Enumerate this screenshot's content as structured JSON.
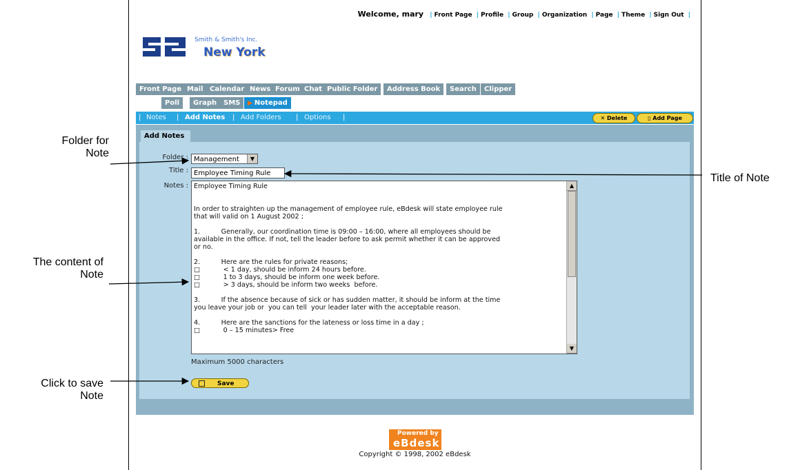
{
  "topnav": {
    "welcome": "Welcome, mary",
    "links": [
      "Front Page",
      "Profile",
      "Group",
      "Organization",
      "Page",
      "Theme",
      "Sign Out"
    ]
  },
  "brand": {
    "logo_text": "S2",
    "company": "Smith & Smith's Inc.",
    "city": "New York"
  },
  "tabs_row1": [
    "Front Page",
    "Mail",
    "Calendar",
    "News",
    "Forum",
    "Chat",
    "Public Folder",
    "Address Book",
    "Search",
    "Clipper"
  ],
  "tabs_row2": [
    "Poll",
    "Graph",
    "SMS",
    "Notepad"
  ],
  "active_tab": "Notepad",
  "subnav": {
    "items": [
      "Notes",
      "Add Notes",
      "Add Folders",
      "Options"
    ],
    "active": "Add Notes",
    "delete_label": "Delete",
    "add_page_label": "Add Page"
  },
  "form": {
    "section_title": "Add Notes",
    "folder_label": "Folder :",
    "folder_value": "Management",
    "title_label": "Title :",
    "title_value": "Employee Timing Rule",
    "notes_label": "Notes :",
    "notes_value": "Employee Timing Rule\n\n\nIn order to straighten up the management of employee rule, eBdesk will state employee rule\nthat will valid on 1 August 2002 ;\n\n1.          Generally, our coordination time is 09:00 – 16:00, where all employees should be\navailable in the office. If not, tell the leader before to ask permit whether it can be approved\nor no.\n\n2.          Here are the rules for private reasons;\n□           < 1 day, should be inform 24 hours before.\n□           1 to 3 days, should be inform one week before.\n□           > 3 days, should be inform two weeks  before.\n\n3.          If the absence because of sick or has sudden matter, it should be inform at the time\nyou leave your job or  you can tell  your leader later with the acceptable reason.\n\n4.          Here are the sanctions for the lateness or loss time in a day ;\n□           0 – 15 minutes> Free",
    "max_chars_text": "Maximum 5000 characters",
    "save_label": "Save"
  },
  "footer": {
    "powered_line1": "Powered by",
    "powered_line2": "eBdesk",
    "copyright": "Copyright © 1998, 2002 eBdesk"
  },
  "annotations": {
    "folder": [
      "Folder for",
      "Note"
    ],
    "title": "Title of Note",
    "content": [
      "The content of",
      "Note"
    ],
    "save": [
      "Click to save",
      "Note"
    ]
  },
  "colors": {
    "tab_gray": "#7d98a5",
    "tab_active": "#1c8fd0",
    "subbar": "#2ca8e0",
    "panel": "#8fb3c6",
    "panel_inner": "#b8d8ea",
    "button_yellow": "#f2d340",
    "powered_orange": "#f0831e"
  }
}
